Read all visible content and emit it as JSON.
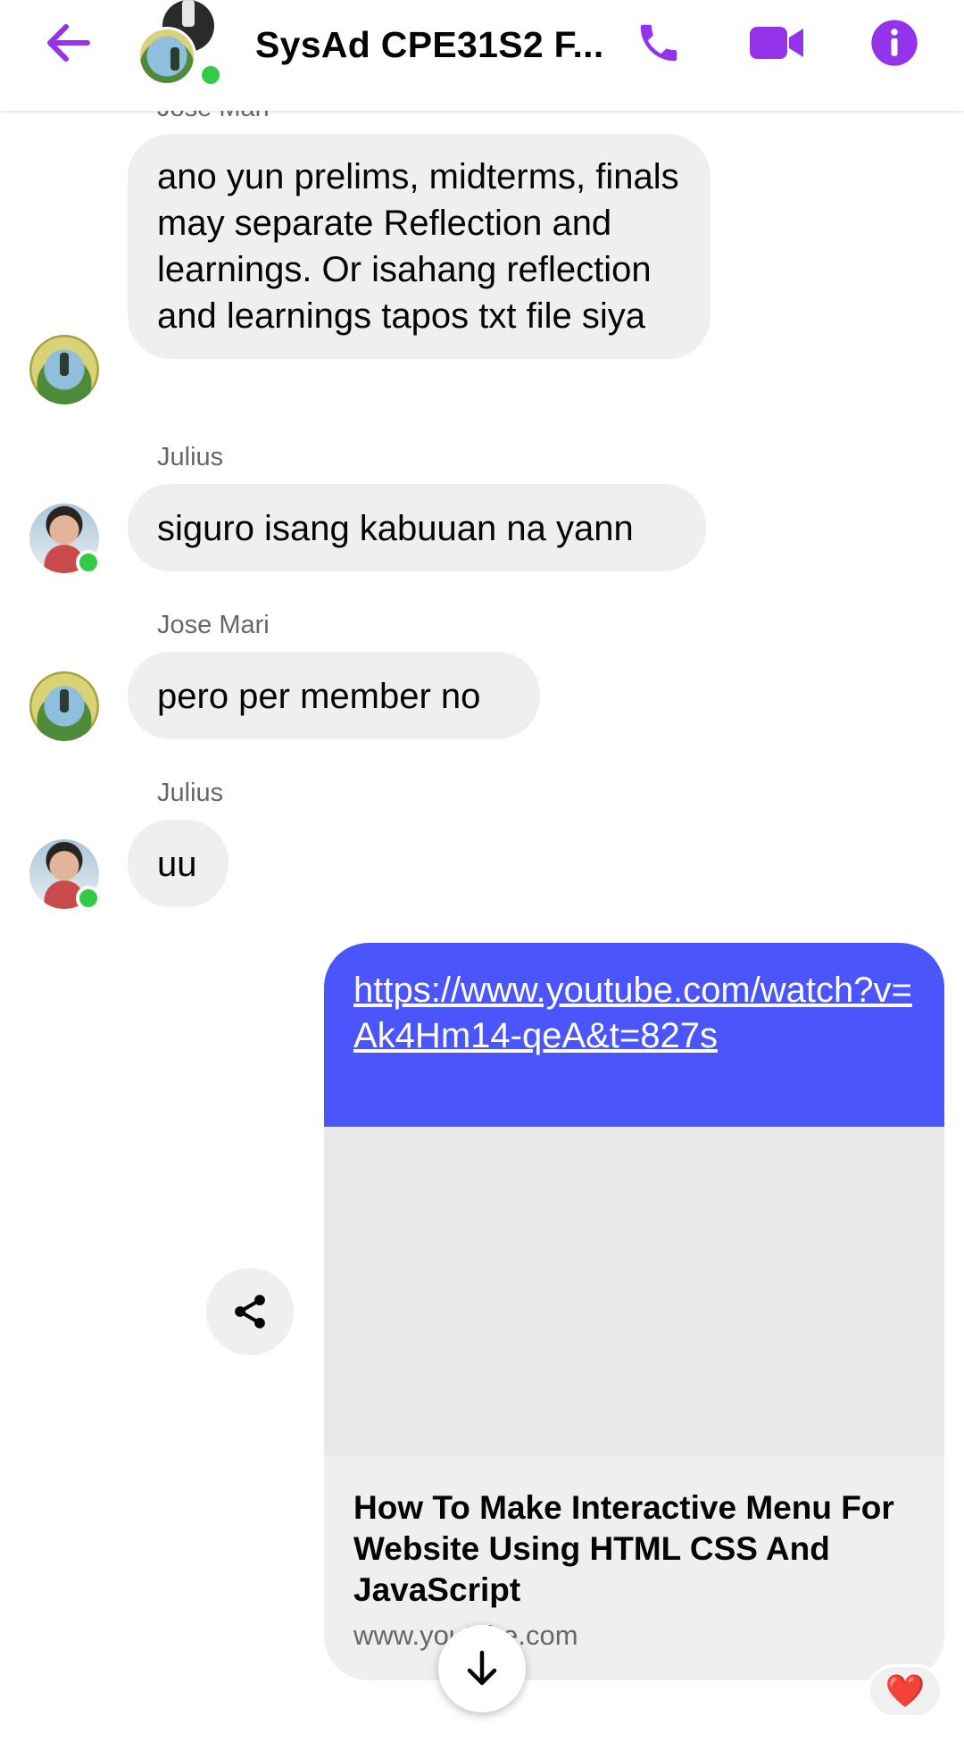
{
  "header": {
    "title": "SysAd CPE31S2 F...",
    "back_icon": "arrow-left-icon",
    "call_icon": "phone-icon",
    "video_icon": "video-camera-icon",
    "info_icon": "info-icon",
    "accent_color": "#9333ea",
    "online_color": "#31cc46"
  },
  "messages": [
    {
      "sender": "Jose Mari",
      "text": "ano yun prelims, midterms, finals may separate Reflection and learnings. Or isahang reflection and learnings tapos txt file siya"
    },
    {
      "sender": "Julius",
      "text": "siguro isang kabuuan na yann"
    },
    {
      "sender": "Jose Mari",
      "text": "pero per member no"
    },
    {
      "sender": "Julius",
      "text": "uu"
    }
  ],
  "outgoing": {
    "link_text": "https://www.youtube.com/watch?v=Ak4Hm14-qeA&t=827s",
    "preview_title": "How To Make Interactive Menu For Website Using HTML CSS And JavaScript",
    "preview_domain": "www.youtube.com",
    "bubble_color": "#4a55fb",
    "reaction": "❤️"
  },
  "controls": {
    "share_icon": "share-icon",
    "scroll_down_icon": "arrow-down-icon"
  }
}
